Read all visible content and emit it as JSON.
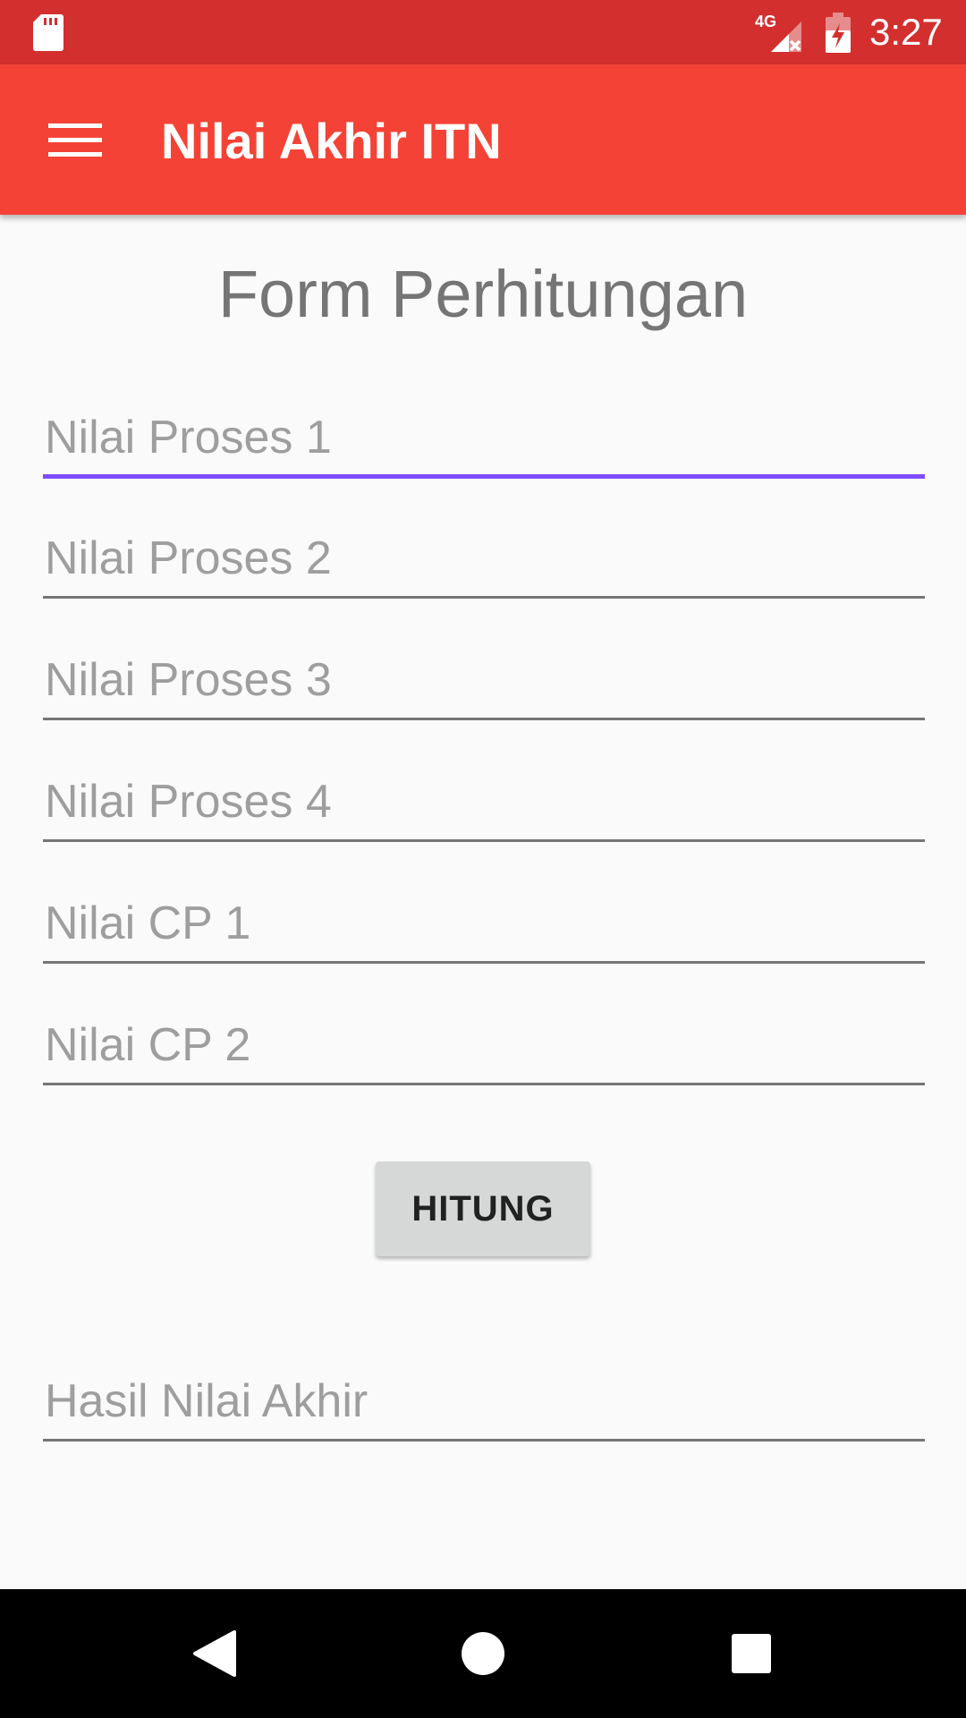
{
  "status_bar": {
    "time": "3:27",
    "network_label": "4G",
    "icons": [
      "sd-card-icon",
      "signal-no-data-icon",
      "battery-charging-icon"
    ]
  },
  "app_bar": {
    "title": "Nilai Akhir ITN",
    "menu_icon": "hamburger-menu-icon"
  },
  "form": {
    "heading": "Form Perhitungan",
    "fields": [
      {
        "placeholder": "Nilai Proses 1",
        "value": "",
        "focused": true
      },
      {
        "placeholder": "Nilai Proses 2",
        "value": ""
      },
      {
        "placeholder": "Nilai Proses 3",
        "value": ""
      },
      {
        "placeholder": "Nilai Proses 4",
        "value": ""
      },
      {
        "placeholder": "Nilai CP 1",
        "value": ""
      },
      {
        "placeholder": "Nilai CP 2",
        "value": ""
      }
    ],
    "button_label": "HITUNG",
    "result": {
      "placeholder": "Hasil Nilai Akhir",
      "value": ""
    }
  },
  "nav_bar": {
    "icons": [
      "back-icon",
      "home-icon",
      "recents-icon"
    ]
  },
  "colors": {
    "status_bar": "#d32f2f",
    "app_bar": "#f44336",
    "focus_accent": "#7c4dff",
    "button_bg": "#d6d7d7"
  }
}
